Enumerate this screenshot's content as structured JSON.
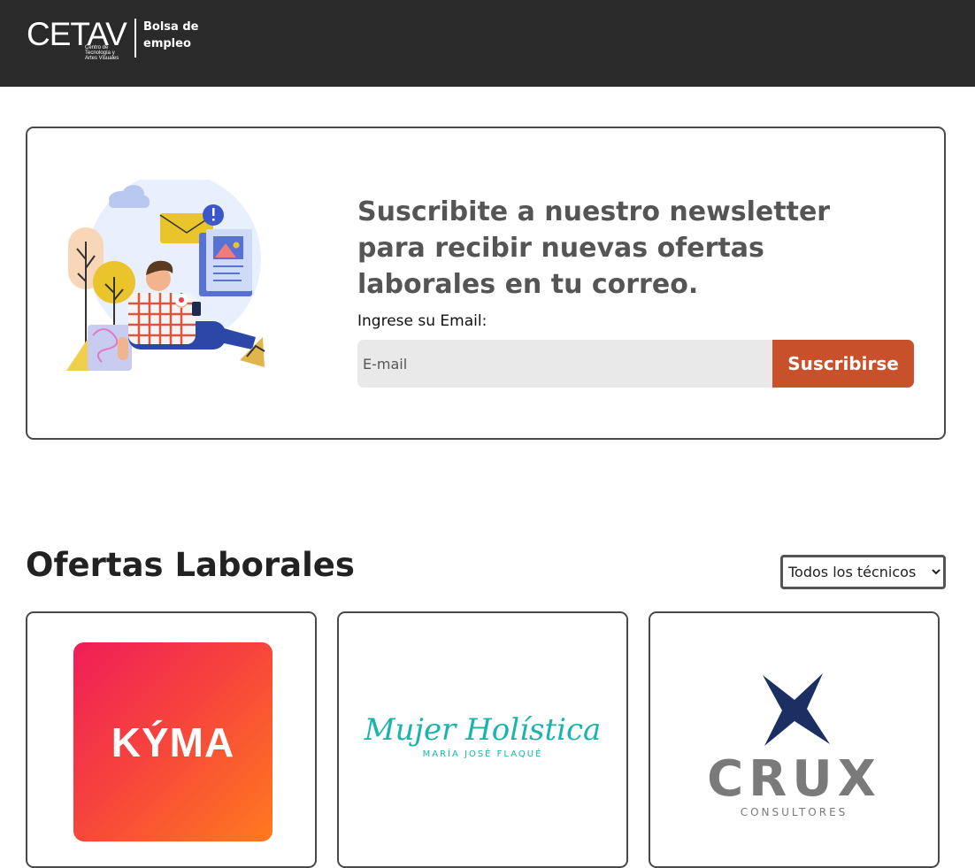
{
  "header": {
    "logo_text": "CETAV",
    "logo_subtext": "Centro de\nTecnología y\nArtes Visuales",
    "caption": "Bolsa de\nempleo"
  },
  "newsletter": {
    "title": "Suscribite a nuestro newsletter para recibir nuevas ofertas laborales en tu correo.",
    "email_label": "Ingrese su Email:",
    "email_placeholder": "E-mail",
    "email_value": "",
    "button_label": "Suscribirse"
  },
  "offers": {
    "title": "Ofertas Laborales",
    "filter_selected": "Todos los técnicos",
    "cards": [
      {
        "company_logo_text": "KÝMA"
      },
      {
        "company_logo_text": "Mujer Holística",
        "company_logo_subtext": "MARÍA JOSÉ FLAQUÉ"
      },
      {
        "company_logo_text": "CRUX",
        "company_logo_subtext": "CONSULTORES"
      }
    ]
  },
  "colors": {
    "header_bg": "#2a2a2a",
    "accent_button": "#c8502b",
    "title_gray": "#555555",
    "teal": "#1ab3ad",
    "navy": "#1b2f63"
  }
}
